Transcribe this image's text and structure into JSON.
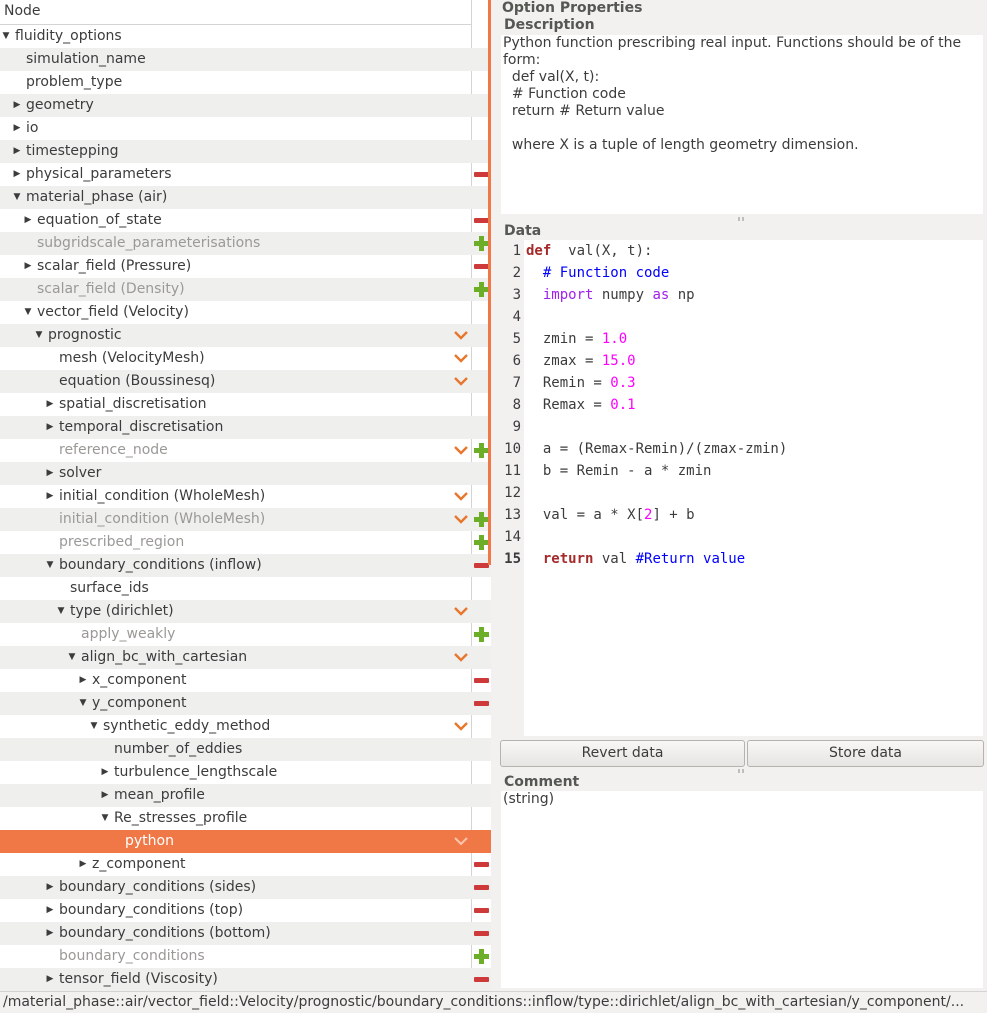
{
  "tree": {
    "header": "Node",
    "rows": [
      {
        "label": "fluidity_options",
        "indent": 0,
        "arrow": "down",
        "action": "",
        "inactive": false
      },
      {
        "label": "simulation_name",
        "indent": 1,
        "arrow": "",
        "action": "",
        "inactive": false
      },
      {
        "label": "problem_type",
        "indent": 1,
        "arrow": "",
        "action": "",
        "inactive": false
      },
      {
        "label": "geometry",
        "indent": 1,
        "arrow": "right",
        "action": "",
        "inactive": false
      },
      {
        "label": "io",
        "indent": 1,
        "arrow": "right",
        "action": "",
        "inactive": false
      },
      {
        "label": "timestepping",
        "indent": 1,
        "arrow": "right",
        "action": "",
        "inactive": false
      },
      {
        "label": "physical_parameters",
        "indent": 1,
        "arrow": "right",
        "action": "minus",
        "inactive": false
      },
      {
        "label": "material_phase (air)",
        "indent": 1,
        "arrow": "down",
        "action": "",
        "inactive": false
      },
      {
        "label": "equation_of_state",
        "indent": 2,
        "arrow": "right",
        "action": "minus",
        "inactive": false
      },
      {
        "label": "subgridscale_parameterisations",
        "indent": 2,
        "arrow": "",
        "action": "plus",
        "inactive": true
      },
      {
        "label": "scalar_field (Pressure)",
        "indent": 2,
        "arrow": "right",
        "action": "minus",
        "inactive": false
      },
      {
        "label": "scalar_field (Density)",
        "indent": 2,
        "arrow": "",
        "action": "plus",
        "inactive": true
      },
      {
        "label": "vector_field (Velocity)",
        "indent": 2,
        "arrow": "down",
        "action": "",
        "inactive": false
      },
      {
        "label": "prognostic",
        "indent": 3,
        "arrow": "down",
        "action": "chev",
        "inactive": false
      },
      {
        "label": "mesh (VelocityMesh)",
        "indent": 4,
        "arrow": "",
        "action": "chev",
        "inactive": false
      },
      {
        "label": "equation (Boussinesq)",
        "indent": 4,
        "arrow": "",
        "action": "chev",
        "inactive": false
      },
      {
        "label": "spatial_discretisation",
        "indent": 4,
        "arrow": "right",
        "action": "",
        "inactive": false
      },
      {
        "label": "temporal_discretisation",
        "indent": 4,
        "arrow": "right",
        "action": "",
        "inactive": false
      },
      {
        "label": "reference_node",
        "indent": 4,
        "arrow": "",
        "action": "chev-plus",
        "inactive": true
      },
      {
        "label": "solver",
        "indent": 4,
        "arrow": "right",
        "action": "",
        "inactive": false
      },
      {
        "label": "initial_condition (WholeMesh)",
        "indent": 4,
        "arrow": "right",
        "action": "chev",
        "inactive": false
      },
      {
        "label": "initial_condition (WholeMesh)",
        "indent": 4,
        "arrow": "",
        "action": "chev-plus",
        "inactive": true
      },
      {
        "label": "prescribed_region",
        "indent": 4,
        "arrow": "",
        "action": "plus",
        "inactive": true
      },
      {
        "label": "boundary_conditions (inflow)",
        "indent": 4,
        "arrow": "down",
        "action": "minus",
        "inactive": false
      },
      {
        "label": "surface_ids",
        "indent": 5,
        "arrow": "",
        "action": "",
        "inactive": false
      },
      {
        "label": "type (dirichlet)",
        "indent": 5,
        "arrow": "down",
        "action": "chev",
        "inactive": false
      },
      {
        "label": "apply_weakly",
        "indent": 6,
        "arrow": "",
        "action": "plus",
        "inactive": true
      },
      {
        "label": "align_bc_with_cartesian",
        "indent": 6,
        "arrow": "down",
        "action": "chev",
        "inactive": false
      },
      {
        "label": "x_component",
        "indent": 7,
        "arrow": "right",
        "action": "minus",
        "inactive": false
      },
      {
        "label": "y_component",
        "indent": 7,
        "arrow": "down",
        "action": "minus",
        "inactive": false
      },
      {
        "label": "synthetic_eddy_method",
        "indent": 8,
        "arrow": "down",
        "action": "chev",
        "inactive": false
      },
      {
        "label": "number_of_eddies",
        "indent": 9,
        "arrow": "",
        "action": "",
        "inactive": false
      },
      {
        "label": "turbulence_lengthscale",
        "indent": 9,
        "arrow": "right",
        "action": "",
        "inactive": false
      },
      {
        "label": "mean_profile",
        "indent": 9,
        "arrow": "right",
        "action": "",
        "inactive": false
      },
      {
        "label": "Re_stresses_profile",
        "indent": 9,
        "arrow": "down",
        "action": "",
        "inactive": false
      },
      {
        "label": "python",
        "indent": 10,
        "arrow": "",
        "action": "chev",
        "inactive": false,
        "selected": true
      },
      {
        "label": "z_component",
        "indent": 7,
        "arrow": "right",
        "action": "minus",
        "inactive": false
      },
      {
        "label": "boundary_conditions (sides)",
        "indent": 4,
        "arrow": "right",
        "action": "minus",
        "inactive": false
      },
      {
        "label": "boundary_conditions (top)",
        "indent": 4,
        "arrow": "right",
        "action": "minus",
        "inactive": false
      },
      {
        "label": "boundary_conditions (bottom)",
        "indent": 4,
        "arrow": "right",
        "action": "minus",
        "inactive": false
      },
      {
        "label": "boundary_conditions",
        "indent": 4,
        "arrow": "",
        "action": "plus",
        "inactive": true
      },
      {
        "label": "tensor_field (Viscosity)",
        "indent": 4,
        "arrow": "right",
        "action": "minus",
        "inactive": false
      }
    ]
  },
  "options": {
    "title": "Option Properties",
    "description_title": "Description",
    "description_lines": [
      "Python function prescribing real input. Functions should be of the",
      "form:",
      "  def val(X, t):",
      "  # Function code",
      "  return # Return value",
      "",
      "  where X is a tuple of length geometry dimension."
    ],
    "data_title": "Data",
    "code_lines": [
      [
        [
          "kw",
          "def"
        ],
        [
          "",
          "  val(X, t):"
        ]
      ],
      [
        [
          "",
          "  "
        ],
        [
          "cm",
          "# Function code"
        ]
      ],
      [
        [
          "",
          "  "
        ],
        [
          "kw2",
          "import"
        ],
        [
          "",
          " numpy "
        ],
        [
          "kw2",
          "as"
        ],
        [
          "",
          " np"
        ]
      ],
      [],
      [
        [
          "",
          "  zmin = "
        ],
        [
          "nm",
          "1.0"
        ]
      ],
      [
        [
          "",
          "  zmax = "
        ],
        [
          "nm",
          "15.0"
        ]
      ],
      [
        [
          "",
          "  Remin = "
        ],
        [
          "nm",
          "0.3"
        ]
      ],
      [
        [
          "",
          "  Remax = "
        ],
        [
          "nm",
          "0.1"
        ]
      ],
      [],
      [
        [
          "",
          "  a = (Remax-Remin)/(zmax-zmin)"
        ]
      ],
      [
        [
          "",
          "  b = Remin - a * zmin"
        ]
      ],
      [],
      [
        [
          "",
          "  val = a * X["
        ],
        [
          "nm",
          "2"
        ],
        [
          "",
          "] + b"
        ]
      ],
      [],
      [
        [
          "",
          "  "
        ],
        [
          "kw",
          "return"
        ],
        [
          "",
          " val "
        ],
        [
          "cm",
          "#Return value"
        ]
      ]
    ],
    "current_line": 15,
    "revert_label": "Revert data",
    "store_label": "Store data",
    "comment_title": "Comment",
    "comment_value": "(string)"
  },
  "status_path": "/material_phase::air/vector_field::Velocity/prognostic/boundary_conditions::inflow/type::dirichlet/align_bc_with_cartesian/y_component/...",
  "colors": {
    "selection": "#f07746",
    "minus": "#ce3a3a",
    "plus": "#6cae27",
    "chevron": "#e8772e"
  }
}
